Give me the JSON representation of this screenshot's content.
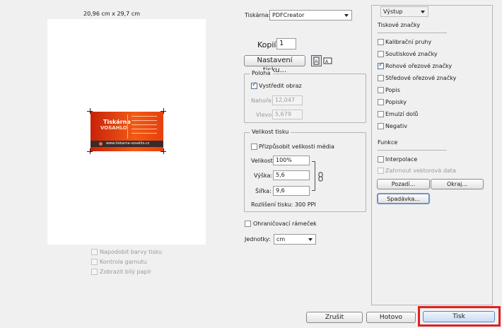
{
  "preview": {
    "paper_size_label": "20,96 cm x 29,7 cm",
    "card": {
      "logo_line1": "Tiskárna",
      "logo_line2": "VOSAHLO",
      "url": "www.tiskarna-vosahlo.cz",
      "accent": "#e23a10"
    },
    "options": [
      {
        "label": "Napodobit barvy tisku",
        "checked": false
      },
      {
        "label": "Kontrola gamutu",
        "checked": false
      },
      {
        "label": "Zobrazit bílý papír",
        "checked": false
      }
    ]
  },
  "printer": {
    "label": "Tiskárna:",
    "value": "PDFCreator"
  },
  "copies": {
    "label": "Kopií:",
    "value": "1"
  },
  "print_setup_button": "Nastavení tisku...",
  "position": {
    "legend": "Poloha",
    "center_label": "Vystředit obraz",
    "center_checked": true,
    "top_label": "Nahoře:",
    "top_value": "12,047",
    "left_label": "Vlevo:",
    "left_value": "5,679"
  },
  "print_size": {
    "legend": "Velikost tisku",
    "fit_label": "Přizpůsobit velikosti média",
    "fit_checked": false,
    "scale_label": "Velikost:",
    "scale_value": "100%",
    "height_label": "Výška:",
    "height_value": "5,6",
    "width_label": "Šířka:",
    "width_value": "9,6",
    "resolution_label": "Rozlišení tisku: 300 PPI"
  },
  "bounding_box": {
    "label": "Ohraničovací rámeček",
    "checked": false
  },
  "units": {
    "label": "Jednotky:",
    "value": "cm"
  },
  "output": {
    "dropdown": "Výstup",
    "marks_heading": "Tiskové značky",
    "marks": [
      {
        "label": "Kalibrační pruhy",
        "checked": false
      },
      {
        "label": "Soutiskové značky",
        "checked": false
      },
      {
        "label": "Rohové ořezové značky",
        "checked": true
      },
      {
        "label": "Středové ořezové značky",
        "checked": false
      },
      {
        "label": "Popis",
        "checked": false
      },
      {
        "label": "Popisky",
        "checked": false
      },
      {
        "label": "Emulzí dolů",
        "checked": false
      },
      {
        "label": "Negativ",
        "checked": false
      }
    ],
    "functions_heading": "Funkce",
    "interpolation_label": "Interpolace",
    "vector_label": "Zahrnout vektorová data",
    "background_button": "Pozadí...",
    "border_button": "Okraj...",
    "bleed_button": "Spadávka..."
  },
  "footer": {
    "cancel": "Zrušit",
    "done": "Hotovo",
    "print": "Tisk",
    "highlight": "#e02020"
  }
}
